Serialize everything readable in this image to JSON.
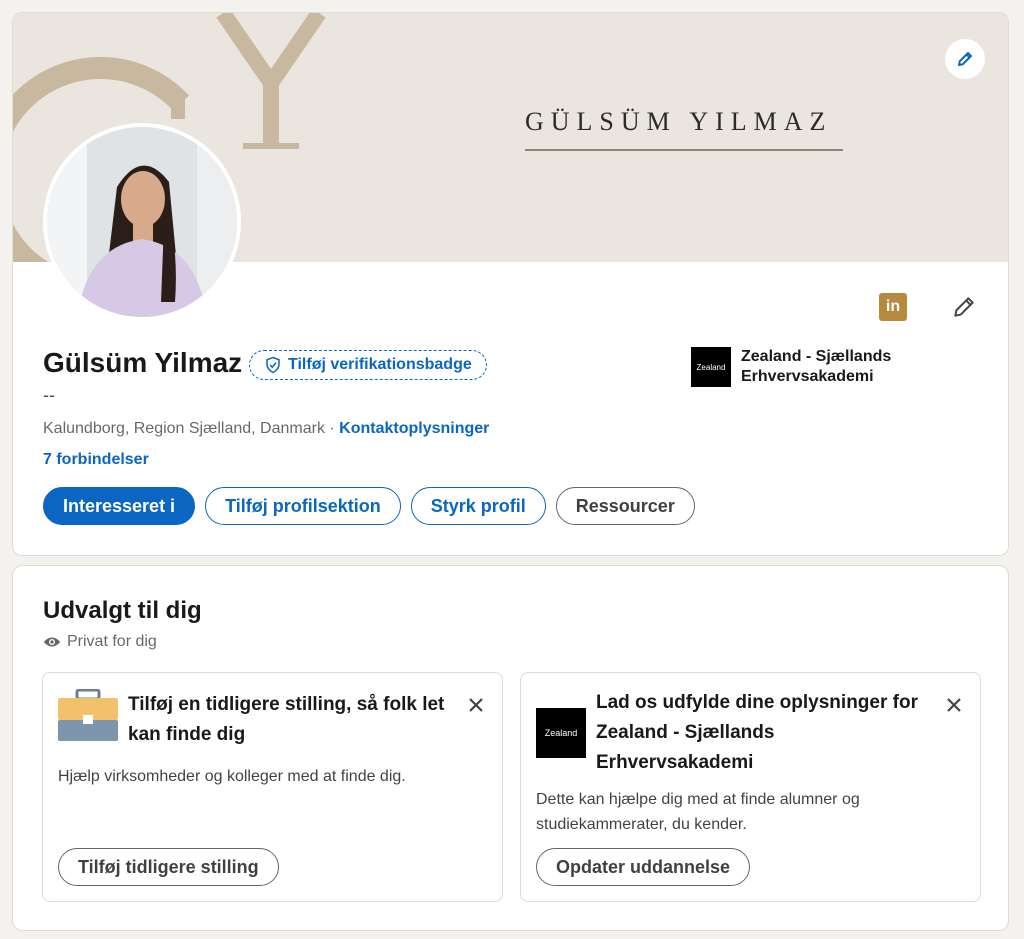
{
  "profile": {
    "banner_name": "GÜLSÜM YILMAZ",
    "name": "Gülsüm Yilmaz",
    "verify_badge": "Tilføj verifikationsbadge",
    "headline": "--",
    "location": "Kalundborg, Region Sjælland, Danmark",
    "separator": " · ",
    "contact_link": "Kontaktoplysninger",
    "connections": "7 forbindelser",
    "linkedin_icon_text": "in",
    "education": {
      "logo_text": "Zealand",
      "name": "Zealand - Sjællands Erhvervsakademi"
    },
    "actions": {
      "interested": "Interesseret i",
      "add_section": "Tilføj profilsektion",
      "enhance": "Styrk profil",
      "resources": "Ressourcer"
    }
  },
  "featured": {
    "title": "Udvalgt til dig",
    "private": "Privat for dig",
    "suggestions": [
      {
        "title": "Tilføj en tidligere stilling, så folk let kan finde dig",
        "description": "Hjælp virksomheder og kolleger med at finde dig.",
        "button": "Tilføj tidligere stilling"
      },
      {
        "logo_text": "Zealand",
        "title": "Lad os udfylde dine oplysninger for Zealand - Sjællands Erhvervsakademi",
        "description": "Dette kan hjælpe dig med at finde alumner og studiekammerater, du kender.",
        "button": "Opdater uddannelse"
      }
    ]
  },
  "colors": {
    "brand_blue": "#0a66c2",
    "banner_bg": "#ebe5df",
    "banner_accent": "#c8b89f",
    "linkedin_icon_bg": "#b58a3e"
  }
}
